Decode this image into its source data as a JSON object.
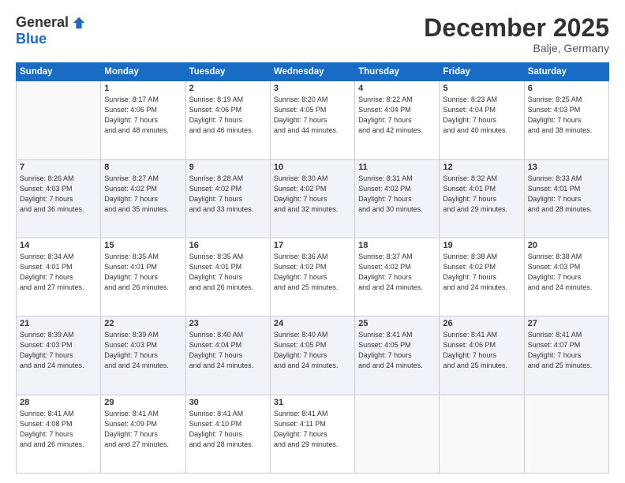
{
  "logo": {
    "general": "General",
    "blue": "Blue"
  },
  "header": {
    "month": "December 2025",
    "location": "Balje, Germany"
  },
  "weekdays": [
    "Sunday",
    "Monday",
    "Tuesday",
    "Wednesday",
    "Thursday",
    "Friday",
    "Saturday"
  ],
  "weeks": [
    [
      {
        "day": "",
        "sunrise": "",
        "sunset": "",
        "daylight": ""
      },
      {
        "day": "1",
        "sunrise": "Sunrise: 8:17 AM",
        "sunset": "Sunset: 4:06 PM",
        "daylight": "Daylight: 7 hours and 48 minutes."
      },
      {
        "day": "2",
        "sunrise": "Sunrise: 8:19 AM",
        "sunset": "Sunset: 4:06 PM",
        "daylight": "Daylight: 7 hours and 46 minutes."
      },
      {
        "day": "3",
        "sunrise": "Sunrise: 8:20 AM",
        "sunset": "Sunset: 4:05 PM",
        "daylight": "Daylight: 7 hours and 44 minutes."
      },
      {
        "day": "4",
        "sunrise": "Sunrise: 8:22 AM",
        "sunset": "Sunset: 4:04 PM",
        "daylight": "Daylight: 7 hours and 42 minutes."
      },
      {
        "day": "5",
        "sunrise": "Sunrise: 8:23 AM",
        "sunset": "Sunset: 4:04 PM",
        "daylight": "Daylight: 7 hours and 40 minutes."
      },
      {
        "day": "6",
        "sunrise": "Sunrise: 8:25 AM",
        "sunset": "Sunset: 4:03 PM",
        "daylight": "Daylight: 7 hours and 38 minutes."
      }
    ],
    [
      {
        "day": "7",
        "sunrise": "Sunrise: 8:26 AM",
        "sunset": "Sunset: 4:03 PM",
        "daylight": "Daylight: 7 hours and 36 minutes."
      },
      {
        "day": "8",
        "sunrise": "Sunrise: 8:27 AM",
        "sunset": "Sunset: 4:02 PM",
        "daylight": "Daylight: 7 hours and 35 minutes."
      },
      {
        "day": "9",
        "sunrise": "Sunrise: 8:28 AM",
        "sunset": "Sunset: 4:02 PM",
        "daylight": "Daylight: 7 hours and 33 minutes."
      },
      {
        "day": "10",
        "sunrise": "Sunrise: 8:30 AM",
        "sunset": "Sunset: 4:02 PM",
        "daylight": "Daylight: 7 hours and 32 minutes."
      },
      {
        "day": "11",
        "sunrise": "Sunrise: 8:31 AM",
        "sunset": "Sunset: 4:02 PM",
        "daylight": "Daylight: 7 hours and 30 minutes."
      },
      {
        "day": "12",
        "sunrise": "Sunrise: 8:32 AM",
        "sunset": "Sunset: 4:01 PM",
        "daylight": "Daylight: 7 hours and 29 minutes."
      },
      {
        "day": "13",
        "sunrise": "Sunrise: 8:33 AM",
        "sunset": "Sunset: 4:01 PM",
        "daylight": "Daylight: 7 hours and 28 minutes."
      }
    ],
    [
      {
        "day": "14",
        "sunrise": "Sunrise: 8:34 AM",
        "sunset": "Sunset: 4:01 PM",
        "daylight": "Daylight: 7 hours and 27 minutes."
      },
      {
        "day": "15",
        "sunrise": "Sunrise: 8:35 AM",
        "sunset": "Sunset: 4:01 PM",
        "daylight": "Daylight: 7 hours and 26 minutes."
      },
      {
        "day": "16",
        "sunrise": "Sunrise: 8:35 AM",
        "sunset": "Sunset: 4:01 PM",
        "daylight": "Daylight: 7 hours and 26 minutes."
      },
      {
        "day": "17",
        "sunrise": "Sunrise: 8:36 AM",
        "sunset": "Sunset: 4:02 PM",
        "daylight": "Daylight: 7 hours and 25 minutes."
      },
      {
        "day": "18",
        "sunrise": "Sunrise: 8:37 AM",
        "sunset": "Sunset: 4:02 PM",
        "daylight": "Daylight: 7 hours and 24 minutes."
      },
      {
        "day": "19",
        "sunrise": "Sunrise: 8:38 AM",
        "sunset": "Sunset: 4:02 PM",
        "daylight": "Daylight: 7 hours and 24 minutes."
      },
      {
        "day": "20",
        "sunrise": "Sunrise: 8:38 AM",
        "sunset": "Sunset: 4:03 PM",
        "daylight": "Daylight: 7 hours and 24 minutes."
      }
    ],
    [
      {
        "day": "21",
        "sunrise": "Sunrise: 8:39 AM",
        "sunset": "Sunset: 4:03 PM",
        "daylight": "Daylight: 7 hours and 24 minutes."
      },
      {
        "day": "22",
        "sunrise": "Sunrise: 8:39 AM",
        "sunset": "Sunset: 4:03 PM",
        "daylight": "Daylight: 7 hours and 24 minutes."
      },
      {
        "day": "23",
        "sunrise": "Sunrise: 8:40 AM",
        "sunset": "Sunset: 4:04 PM",
        "daylight": "Daylight: 7 hours and 24 minutes."
      },
      {
        "day": "24",
        "sunrise": "Sunrise: 8:40 AM",
        "sunset": "Sunset: 4:05 PM",
        "daylight": "Daylight: 7 hours and 24 minutes."
      },
      {
        "day": "25",
        "sunrise": "Sunrise: 8:41 AM",
        "sunset": "Sunset: 4:05 PM",
        "daylight": "Daylight: 7 hours and 24 minutes."
      },
      {
        "day": "26",
        "sunrise": "Sunrise: 8:41 AM",
        "sunset": "Sunset: 4:06 PM",
        "daylight": "Daylight: 7 hours and 25 minutes."
      },
      {
        "day": "27",
        "sunrise": "Sunrise: 8:41 AM",
        "sunset": "Sunset: 4:07 PM",
        "daylight": "Daylight: 7 hours and 25 minutes."
      }
    ],
    [
      {
        "day": "28",
        "sunrise": "Sunrise: 8:41 AM",
        "sunset": "Sunset: 4:08 PM",
        "daylight": "Daylight: 7 hours and 26 minutes."
      },
      {
        "day": "29",
        "sunrise": "Sunrise: 8:41 AM",
        "sunset": "Sunset: 4:09 PM",
        "daylight": "Daylight: 7 hours and 27 minutes."
      },
      {
        "day": "30",
        "sunrise": "Sunrise: 8:41 AM",
        "sunset": "Sunset: 4:10 PM",
        "daylight": "Daylight: 7 hours and 28 minutes."
      },
      {
        "day": "31",
        "sunrise": "Sunrise: 8:41 AM",
        "sunset": "Sunset: 4:11 PM",
        "daylight": "Daylight: 7 hours and 29 minutes."
      },
      {
        "day": "",
        "sunrise": "",
        "sunset": "",
        "daylight": ""
      },
      {
        "day": "",
        "sunrise": "",
        "sunset": "",
        "daylight": ""
      },
      {
        "day": "",
        "sunrise": "",
        "sunset": "",
        "daylight": ""
      }
    ]
  ]
}
